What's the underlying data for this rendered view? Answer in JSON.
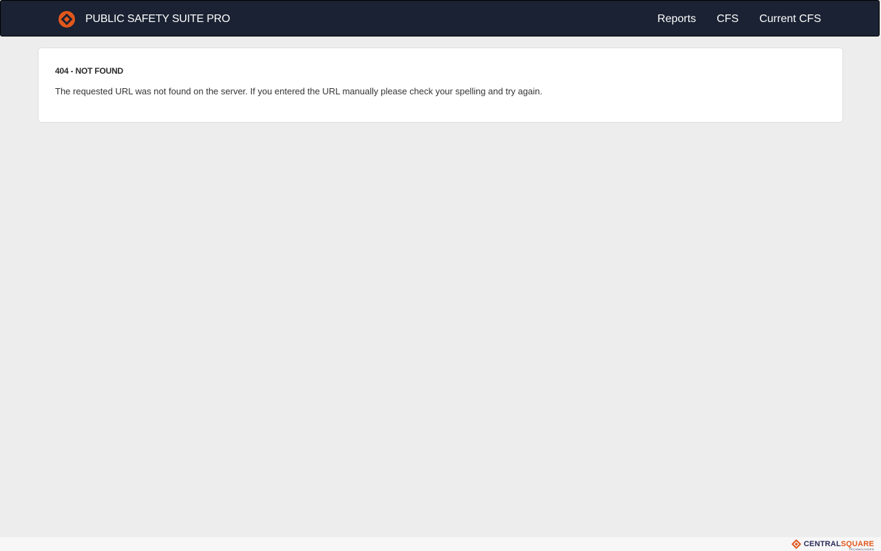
{
  "header": {
    "app_title": "PUBLIC SAFETY SUITE PRO",
    "logo_icon": "centralsquare-diamond-icon",
    "nav": [
      {
        "label": "Reports"
      },
      {
        "label": "CFS"
      },
      {
        "label": "Current CFS"
      }
    ]
  },
  "error": {
    "title": "404 - NOT FOUND",
    "message": "The requested URL was not found on the server. If you entered the URL manually please check your spelling and try again."
  },
  "footer": {
    "logo_part1": "CENTRAL",
    "logo_part2": "SQUARE",
    "logo_sub": "TECHNOLOGIES"
  },
  "colors": {
    "navbar_bg": "#1a2233",
    "page_bg": "#ededed",
    "brand_orange": "#e2571b",
    "brand_navy": "#2a2a5a"
  }
}
